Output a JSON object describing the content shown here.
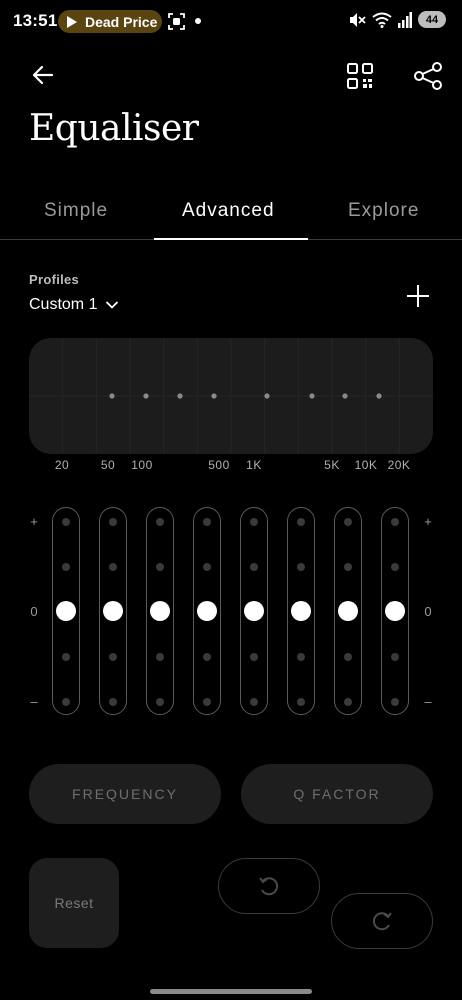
{
  "status_bar": {
    "time": "13:51",
    "notification_pill": "Dead Price",
    "battery": "44",
    "pill_color": "#5a4412"
  },
  "header": {
    "title": "Equaliser",
    "back_icon": "arrow-left-icon",
    "qr_icon": "qr-code-icon",
    "share_icon": "share-icon"
  },
  "tabs": [
    {
      "label": "Simple",
      "active": false
    },
    {
      "label": "Advanced",
      "active": true
    },
    {
      "label": "Explore",
      "active": false
    }
  ],
  "profiles": {
    "label": "Profiles",
    "selected": "Custom 1",
    "add_icon": "plus-icon"
  },
  "frequency_labels": [
    "20",
    "50",
    "100",
    "500",
    "1K",
    "5K",
    "10K",
    "20K"
  ],
  "sliders": {
    "plus_label": "+",
    "zero_label": "0",
    "minus_label": "–",
    "bands": [
      {
        "gain_fraction": 0.5
      },
      {
        "gain_fraction": 0.5
      },
      {
        "gain_fraction": 0.5
      },
      {
        "gain_fraction": 0.5
      },
      {
        "gain_fraction": 0.5
      },
      {
        "gain_fraction": 0.5
      },
      {
        "gain_fraction": 0.5
      },
      {
        "gain_fraction": 0.5
      }
    ]
  },
  "controls": {
    "frequency_label": "FREQUENCY",
    "q_factor_label": "Q  FACTOR",
    "reset_label": "Reset",
    "undo_icon": "undo-icon",
    "redo_icon": "redo-icon"
  }
}
